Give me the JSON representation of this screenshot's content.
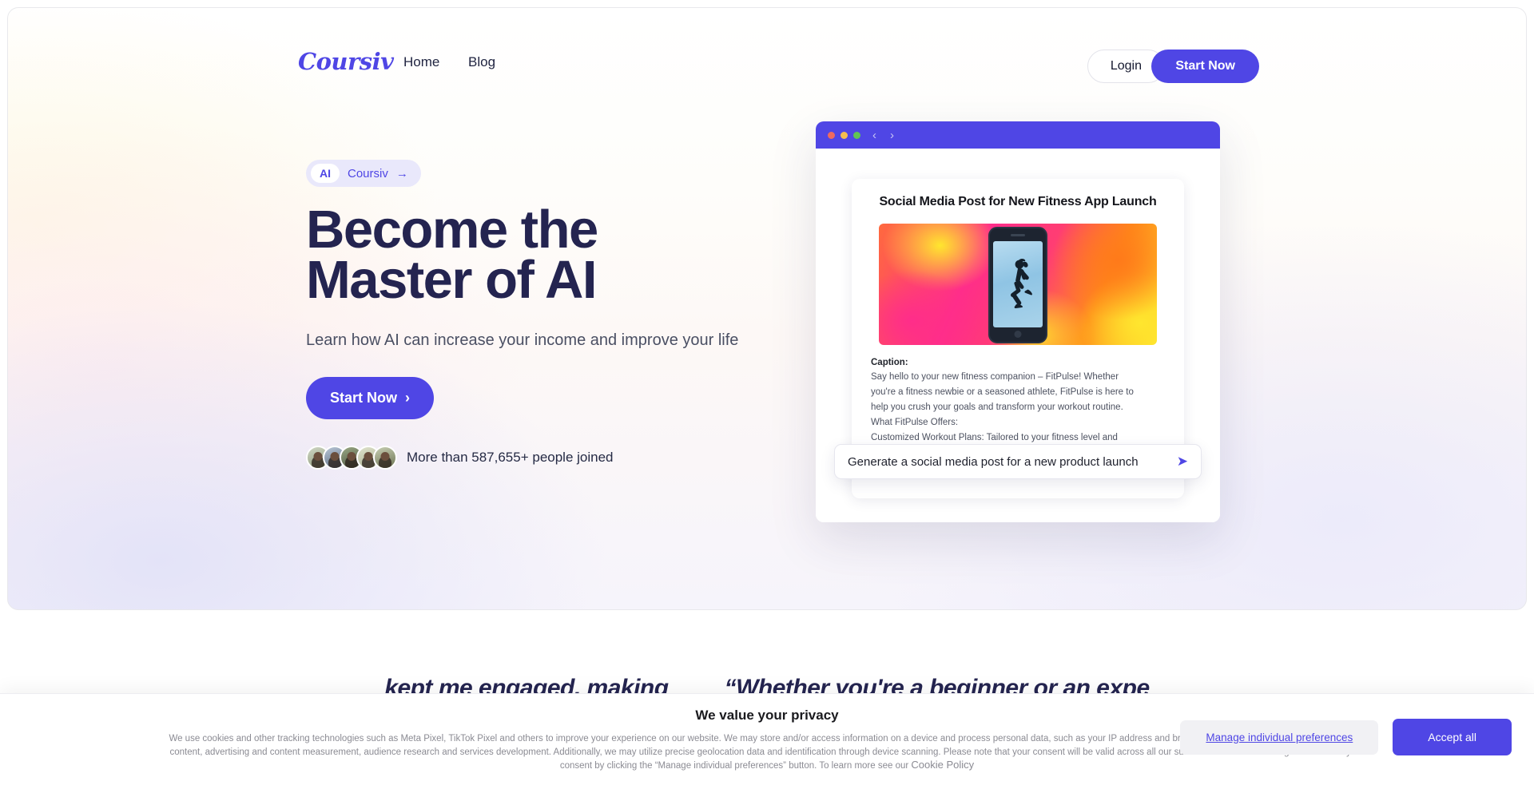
{
  "nav": {
    "logo": "Coursiv",
    "links": [
      {
        "label": "Home"
      },
      {
        "label": "Blog"
      }
    ],
    "login_label": "Login",
    "start_label": "Start Now"
  },
  "hero": {
    "badge_tag": "AI",
    "badge_label": "Coursiv",
    "badge_arrow": "→",
    "headline_line1": "Become the",
    "headline_line2": "Master of AI",
    "subhead": "Learn how AI can increase your income and improve your life",
    "cta_label": "Start Now",
    "cta_chevron": "›",
    "social_proof": "More than 587,655+ people joined"
  },
  "mockup": {
    "chevron_back": "‹",
    "chevron_forward": "›",
    "card_title": "Social Media Post for New Fitness App Launch",
    "caption_label": "Caption:",
    "caption_lines": [
      "Say hello to your new fitness companion – FitPulse! Whether",
      "you're a fitness newbie or a seasoned athlete, FitPulse is here to",
      "help you crush your goals and transform your workout routine.",
      "What FitPulse Offers:",
      "Customized Workout Plans: Tailored to your fitness level and"
    ],
    "prompt_value": "Generate a social media post for a new product launch",
    "send_icon": "➤"
  },
  "testimonials": [
    "kept me engaged, making",
    "“Whether you're a beginner or an expe"
  ],
  "cookie": {
    "title": "We value your privacy",
    "body_line1": "We use cookies and other tracking technologies such as Meta Pixel, TikTok Pixel and others to improve your experience on our website. We may store and/or access information on a device and process personal data, such as your IP address and browsing data, for personalized",
    "body_line2": "advertising and content, advertising and content measurement, audience research and services development. Additionally, we may utilize precise geolocation data and identification through device scanning.  Please note that your consent will be valid across all our subdomains. You can",
    "body_line3": "change or withdraw your consent by clicking the “Manage individual preferences” button. To learn more see our ",
    "policy_link": "Cookie Policy",
    "manage_label": "Manage individual preferences",
    "accept_label": "Accept all"
  },
  "colors": {
    "brand": "#4f46e5",
    "heading": "#242450",
    "body": "#4a4f63"
  }
}
